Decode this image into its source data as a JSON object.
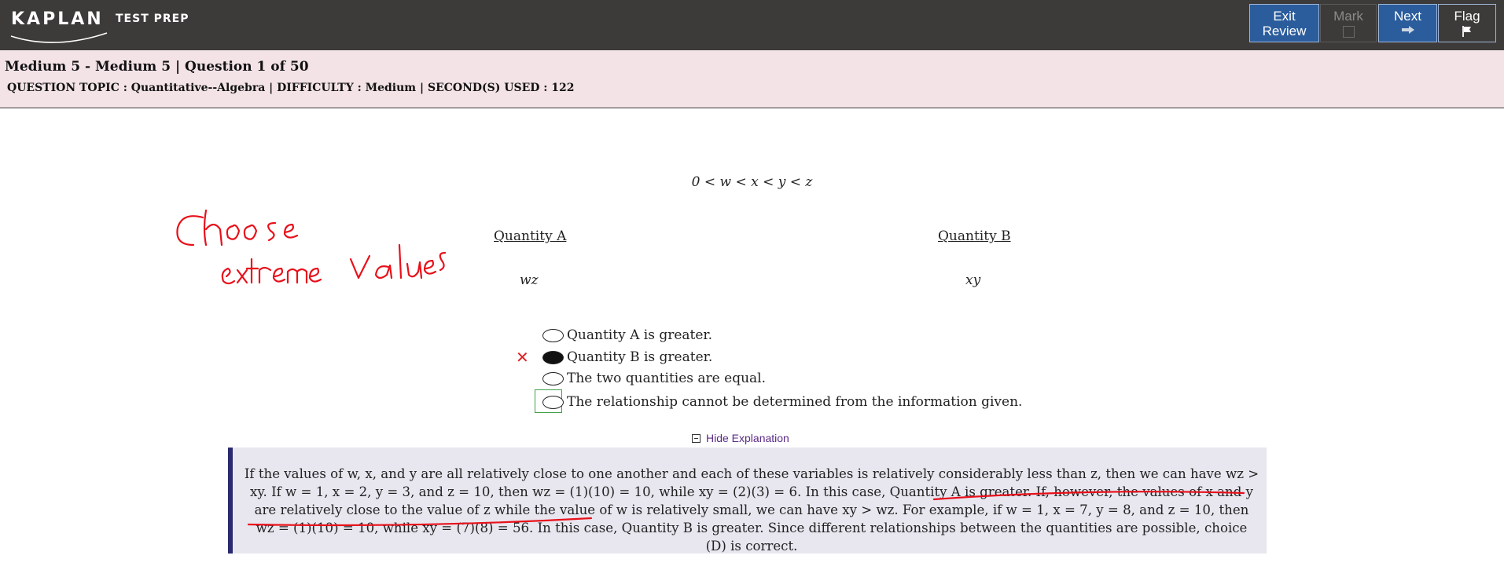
{
  "brand": {
    "logo_main": "KAPLAN",
    "logo_sub": "TEST PREP"
  },
  "toolbar": {
    "exit_line1": "Exit",
    "exit_line2": "Review",
    "mark_label": "Mark",
    "next_label": "Next",
    "flag_label": "Flag"
  },
  "header": {
    "title": "Medium 5 - Medium 5 | Question 1 of 50",
    "meta": "QUESTION TOPIC : Quantitative--Algebra | DIFFICULTY : Medium | SECOND(S) USED : 122"
  },
  "question": {
    "stem": "0 < w < x < y < z",
    "quantity_a_label": "Quantity A",
    "quantity_b_label": "Quantity B",
    "quantity_a_value": "wz",
    "quantity_b_value": "xy",
    "choices": [
      {
        "label": "Quantity A is greater.",
        "selected": false
      },
      {
        "label": "Quantity B is greater.",
        "selected": true,
        "result": "incorrect"
      },
      {
        "label": "The two quantities are equal.",
        "selected": false
      },
      {
        "label": "The relationship cannot be determined from the information given.",
        "selected": false,
        "correct": true
      }
    ],
    "wrong_marker": "✕"
  },
  "explanation": {
    "toggle_label": "Hide Explanation",
    "text": "If the values of w, x, and y are all relatively close to one another and each of these variables is relatively considerably less than z, then we can have wz > xy. If w = 1, x = 2, y = 3, and z = 10, then wz = (1)(10) = 10, while xy = (2)(3) = 6. In this case, Quantity A is greater. If, however, the values of x and y are relatively close to the value of z while the value of w is relatively small, we can have xy > wz. For example, if w = 1, x = 7, y = 8, and z = 10, then wz = (1)(10) = 10, while xy = (7)(8) = 56. In this case, Quantity B is greater. Since different relationships between the quantities are possible, choice (D) is correct."
  },
  "annotation": {
    "handwritten_line1": "choose",
    "handwritten_line2": "extreme values",
    "ink_color": "#e8101a"
  },
  "colors": {
    "topbar": "#3d3b3a",
    "button_blue": "#2b5d9c",
    "info_band": "#f3e3e6",
    "explanation_bg": "#e8e6ef",
    "correct_outline": "#3fa04a"
  }
}
